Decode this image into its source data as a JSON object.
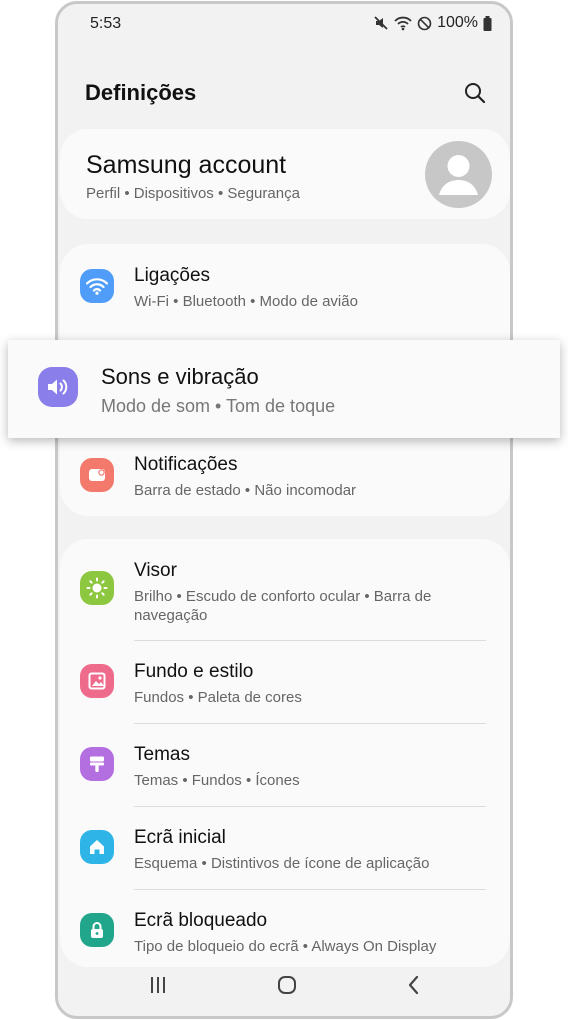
{
  "status_bar": {
    "time": "5:53",
    "battery": "100%",
    "icons": [
      "mute-icon",
      "wifi-icon",
      "do-not-disturb-icon",
      "battery-icon"
    ]
  },
  "header": {
    "title": "Definições",
    "search_icon": "search-icon"
  },
  "account": {
    "name": "Samsung account",
    "subtitle": "Perfil  •  Dispositivos  •  Segurança",
    "avatar_icon": "person-icon"
  },
  "groups": [
    {
      "items": [
        {
          "title": "Ligações",
          "subtitle": "Wi-Fi  •  Bluetooth  •  Modo de avião",
          "icon": "wifi-icon",
          "color": "#4f9df8"
        },
        {
          "title": "Sons e vibração",
          "subtitle": "Modo de som  •  Tom de toque",
          "icon": "volume-icon",
          "color": "#8a7fea",
          "highlighted": true
        },
        {
          "title": "Notificações",
          "subtitle": "Barra de estado  •  Não incomodar",
          "icon": "notification-icon",
          "color": "#f2796b"
        }
      ]
    },
    {
      "items": [
        {
          "title": "Visor",
          "subtitle": "Brilho  •  Escudo de conforto ocular  •  Barra de navegação",
          "icon": "brightness-icon",
          "color": "#8dc63f"
        },
        {
          "title": "Fundo e estilo",
          "subtitle": "Fundos  •  Paleta de cores",
          "icon": "wallpaper-icon",
          "color": "#ee6b8c"
        },
        {
          "title": "Temas",
          "subtitle": "Temas  •  Fundos  •  Ícones",
          "icon": "paint-brush-icon",
          "color": "#b36ee0"
        },
        {
          "title": "Ecrã inicial",
          "subtitle": "Esquema  •  Distintivos de ícone de aplicação",
          "icon": "home-icon",
          "color": "#2fb4e8"
        },
        {
          "title": "Ecrã bloqueado",
          "subtitle": "Tipo de bloqueio do ecrã  •  Always On Display",
          "icon": "lock-icon",
          "color": "#21a68c"
        }
      ]
    }
  ],
  "nav_bar": {
    "icons": [
      "recents-icon",
      "home-button-icon",
      "back-icon"
    ]
  }
}
